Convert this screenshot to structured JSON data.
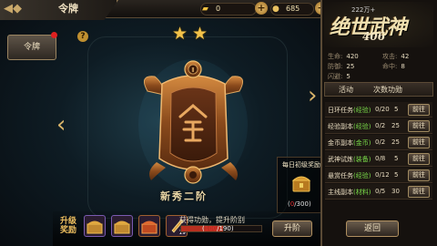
{
  "header": {
    "title": "令牌",
    "back_icon": "back-arrow-icon"
  },
  "resources": [
    {
      "icon": "gold-ingot-icon",
      "value": "0"
    },
    {
      "icon": "coin-icon",
      "value": "685"
    }
  ],
  "left_tab": {
    "label": "令牌",
    "has_notification": true
  },
  "help_icon": "?",
  "token": {
    "stars": 2,
    "rank_name": "新秀二阶"
  },
  "daily_reward": {
    "label": "每日初级奖励",
    "current": "0",
    "total": "/300"
  },
  "upgrade": {
    "label_line1": "升级",
    "label_line2": "奖励",
    "items": [
      {
        "icon": "treasure-chest-icon",
        "count": ""
      },
      {
        "icon": "treasure-chest-icon",
        "count": ""
      },
      {
        "icon": "treasure-chest-icon",
        "count": ""
      },
      {
        "icon": "scroll-icon",
        "count": "19"
      }
    ]
  },
  "merit": {
    "text": "获得功勋，提升阶别",
    "current": "100",
    "total": "/190",
    "progress": 0.526
  },
  "rankup_button": "升阶",
  "right_panel": {
    "vip_text": "222万+",
    "logo_text": "绝世武神",
    "power": "406",
    "stats": [
      {
        "label": "生命:",
        "value": "420"
      },
      {
        "label": "攻击:",
        "value": "42"
      },
      {
        "label": "防御:",
        "value": "25"
      },
      {
        "label": "命中:",
        "value": "8"
      },
      {
        "label": "闪避:",
        "value": "5"
      }
    ],
    "tab_headers": [
      "活动",
      "次数功勋"
    ],
    "tasks": [
      {
        "name": "日环任务",
        "tag": "(经验)",
        "progress": "0/20",
        "points": "5",
        "button": "前往"
      },
      {
        "name": "经验副本",
        "tag": "(经验)",
        "progress": "0/2",
        "points": "25",
        "button": "前往"
      },
      {
        "name": "金币副本",
        "tag": "(金币)",
        "progress": "0/2",
        "points": "25",
        "button": "前往"
      },
      {
        "name": "武神试炼",
        "tag": "(装备)",
        "progress": "0/8",
        "points": "5",
        "button": "前往"
      },
      {
        "name": "悬赏任务",
        "tag": "(经验)",
        "progress": "0/12",
        "points": "5",
        "button": "前往"
      },
      {
        "name": "主线副本",
        "tag": "(材料)",
        "progress": "0/5",
        "points": "30",
        "button": "前往"
      }
    ],
    "return_button": "返回"
  },
  "colors": {
    "accent_gold": "#d9b46a",
    "task_tag": "#7adc4a",
    "merit_fill": "#b83020",
    "notify_red": "#e02020"
  }
}
